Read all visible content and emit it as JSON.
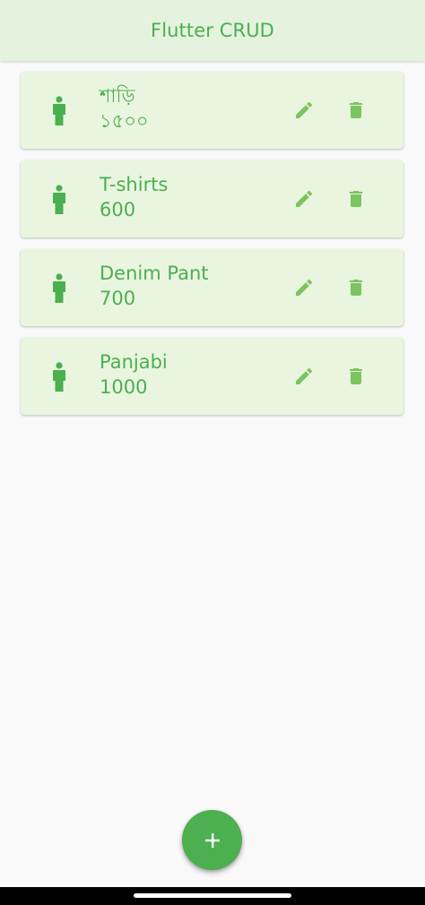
{
  "app": {
    "title": "Flutter CRUD"
  },
  "items": [
    {
      "name": "শাড়ি",
      "price": "১৫০০"
    },
    {
      "name": "T-shirts",
      "price": "600"
    },
    {
      "name": "Denim Pant",
      "price": "700"
    },
    {
      "name": "Panjabi",
      "price": "1000"
    }
  ],
  "icons": {
    "leading": "person-icon",
    "edit": "pencil-icon",
    "delete": "trash-icon",
    "fab": "plus-icon"
  },
  "colors": {
    "accent": "#4caf50",
    "icon_light": "#7dc35f",
    "appbar_bg": "#e4f2de",
    "card_bg": "#e9f5df",
    "page_bg": "#f9f9f9"
  }
}
